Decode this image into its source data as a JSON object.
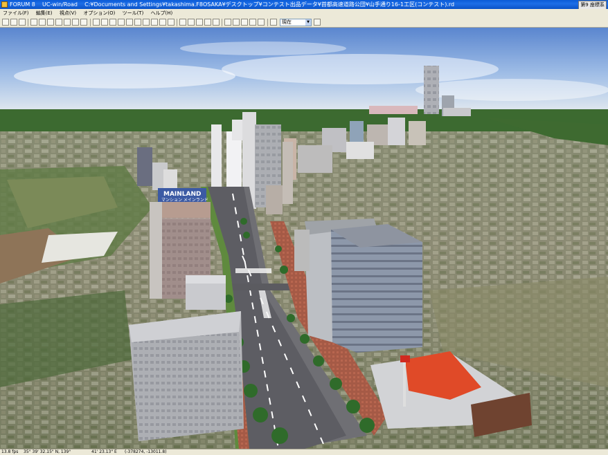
{
  "window": {
    "app_name": "FORUM 8",
    "product": "UC-win/Road",
    "file_path": "C:¥Documents and Settings¥takashima.F8OSAKA¥デスクトップ¥コンテスト出品データ¥首都高速道路公団¥山手通り16-1工区(コンテスト).rd",
    "corner_label": "第9 座標系"
  },
  "menu": [
    "ファイル(F)",
    "編集(E)",
    "視点(V)",
    "オプション(O)",
    "ツール(T)",
    "ヘルプ(H)"
  ],
  "toolbar": {
    "view_select": "現在"
  },
  "scene": {
    "sign_line1": "MAINLAND",
    "sign_line2": "マンション メインランド"
  },
  "status": {
    "fps": "13.8 fps",
    "latitude": "35° 39' 32.15\" N, 139°",
    "longitude": "41' 23.13\" E",
    "coords": "(-378274, -13011.8)"
  }
}
